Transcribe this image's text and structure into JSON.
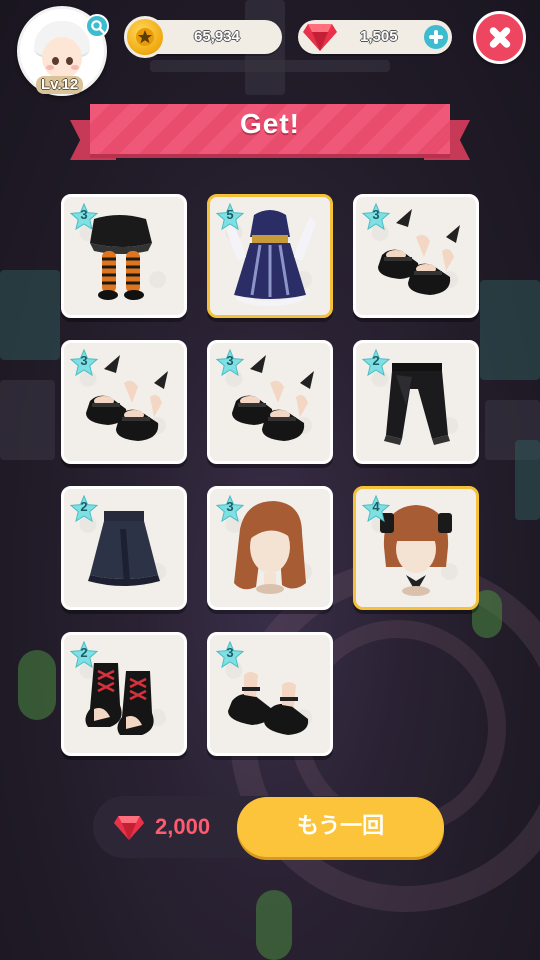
{
  "player": {
    "level_label": "Lv.12"
  },
  "currency": {
    "coins": "65,934",
    "gems": "1,505"
  },
  "banner": {
    "title": "Get!"
  },
  "items": [
    {
      "rarity": "3",
      "kind": "tights-skirt",
      "highlight": false
    },
    {
      "rarity": "5",
      "kind": "dress",
      "highlight": true
    },
    {
      "rarity": "3",
      "kind": "winged-shoes",
      "highlight": false
    },
    {
      "rarity": "3",
      "kind": "winged-shoes",
      "highlight": false
    },
    {
      "rarity": "3",
      "kind": "winged-shoes",
      "highlight": false
    },
    {
      "rarity": "2",
      "kind": "pants",
      "highlight": false
    },
    {
      "rarity": "2",
      "kind": "skirt",
      "highlight": false
    },
    {
      "rarity": "3",
      "kind": "long-hair",
      "highlight": false
    },
    {
      "rarity": "4",
      "kind": "bob-hair",
      "highlight": true
    },
    {
      "rarity": "2",
      "kind": "boots",
      "highlight": false
    },
    {
      "rarity": "3",
      "kind": "strap-shoes",
      "highlight": false
    }
  ],
  "draw": {
    "cost": "2,000",
    "button_label": "もう一回"
  },
  "colors": {
    "gold_border": "#f5c13b",
    "accent_pink": "#ef5878",
    "button_yellow": "#fbc43b",
    "teal": "#3dbbcf"
  }
}
